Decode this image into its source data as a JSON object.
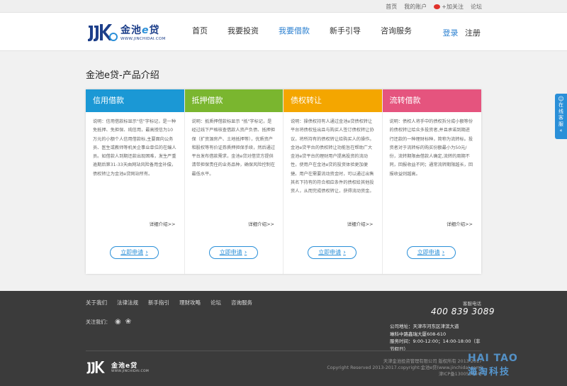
{
  "topbar": {
    "home": "首页",
    "account": "我的账户",
    "follow": "+加关注",
    "forum": "论坛"
  },
  "logo": {
    "cn_prefix": "金池",
    "cn_e": "e",
    "cn_suffix": "贷",
    "url": "WWW.JINCHIDAI.COM"
  },
  "nav": {
    "items": [
      "首页",
      "我要投资",
      "我要借款",
      "新手引导",
      "咨询服务"
    ],
    "active_index": 2
  },
  "auth": {
    "login": "登录",
    "register": "注册"
  },
  "page_title": "金池e贷-产品介绍",
  "cards": [
    {
      "title": "信用借款",
      "color": "#1b98d5",
      "desc": "说明：信用借款标显示\"信\"字标记，是一种免抵押、免担保、纯信用，最高授信为10万元的小额个人信用借款标,主要面向公务员、医生或教师等机关企事业单位的在编人员。如借款人到期还款出现困难，发生严重逾期后第31-33天由网站风险备用金补偿，债权转让为金池e贷网站所有。",
      "more": "详细介绍>>",
      "apply": "立即申请"
    },
    {
      "title": "抵押借款",
      "color": "#7ab62f",
      "desc": "说明：抵质押借款标显示 \"抵\"字标记，是经过线下严格核查借款人资产负债、抵押担保（扩资源房产、土地抵押等），优质资产和股权等有价证券质押担保手续，然后通过平台发布借款需求，金池e贷对借贷方提供清带担保责任的业务品种，确保风险控制在最低水平。",
      "more": "详细介绍>>",
      "apply": "立即申请"
    },
    {
      "title": "债权转让",
      "color": "#f4a600",
      "desc": "说明：操债权持有人通过金池e贷债权转让平台将债权挂出且与购买人签订债权转让协议，将所持有的债权转让给购买人的操作。金池e贷平台的债权转让功能旨在帮助广大金池e贷平台的理财用户提高投资的流动性，使用户在金池e贷的投资体验更加便捷。用户在需要流动资金时，可以通过出售其名下持有的符合相应条件的债权给其他投资人，从而完成债权转让，获得流动资金。",
      "more": "详细介绍>>",
      "apply": "立即申请"
    },
    {
      "title": "流转借款",
      "color": "#e5547e",
      "desc": "说明：债权人将手中的债权拆分成小额等份的债权转让给众多投资者,并且承诺到期进行还款的一种理财标种，简称为流转标。投资者对于流转标的购买份额最小为50元/份，流转期限由借款人确定,流转的周期不同，回报收益不同；通常流转期限越长，回报收益则越高。",
      "more": "详细介绍>>",
      "apply": "立即申请"
    }
  ],
  "side_tab": {
    "label": "在线客服",
    "arrow": "«"
  },
  "footer": {
    "links": [
      "关于我们",
      "法律法规",
      "新手指引",
      "理财攻略",
      "论坛",
      "咨询服务"
    ],
    "follow_label": "关注我们：",
    "hotline_label": "客服电话",
    "hotline": "400  839  3089",
    "address_label": "公司地址：",
    "address": "天津市河东区津滨大道",
    "address2": "琳科中路鑫瑞大厦608-610",
    "hours_label": "服务时间：",
    "hours": "9:00-12:00；14:00-18:00（非节假日）",
    "company": "天津金池投资管理有限公司 版权所有 2013-2017",
    "copyright": "Copyright Reserved 2013-2017.copyright:金池e贷(www.jinchidai.com)",
    "icp": "津ICP备13005366号"
  },
  "watermark": {
    "en": "HAI TAO",
    "cn": "海淘科技"
  }
}
